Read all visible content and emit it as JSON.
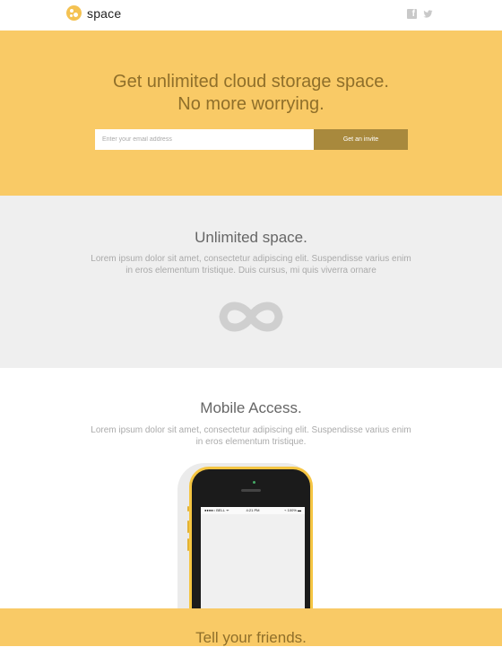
{
  "header": {
    "brand": "space",
    "social": [
      "facebook-icon",
      "twitter-icon"
    ]
  },
  "hero": {
    "title_line1": "Get unlimited cloud storage space.",
    "title_line2": "No more worrying.",
    "email_placeholder": "Enter your email address",
    "cta_label": "Get an invite"
  },
  "features": [
    {
      "title": "Unlimited space.",
      "body_line1": "Lorem ipsum dolor sit amet, consectetur adipiscing elit. Suspendisse varius enim",
      "body_line2": "in eros elementum tristique. Duis cursus, mi quis viverra ornare",
      "icon": "infinity-icon"
    },
    {
      "title": "Mobile Access.",
      "body_line1": "Lorem ipsum dolor sit amet, consectetur adipiscing elit. Suspendisse varius enim",
      "body_line2": "in eros elementum tristique.",
      "phone_status": {
        "carrier": "●●●●○ BELL ᯤ",
        "time": "4:21 PM",
        "battery": "⌁ 100% ▬"
      }
    }
  ],
  "footer": {
    "title": "Tell your friends."
  },
  "colors": {
    "accent": "#f9ca66",
    "cta": "#a8893d",
    "section_gray": "#efefef"
  }
}
